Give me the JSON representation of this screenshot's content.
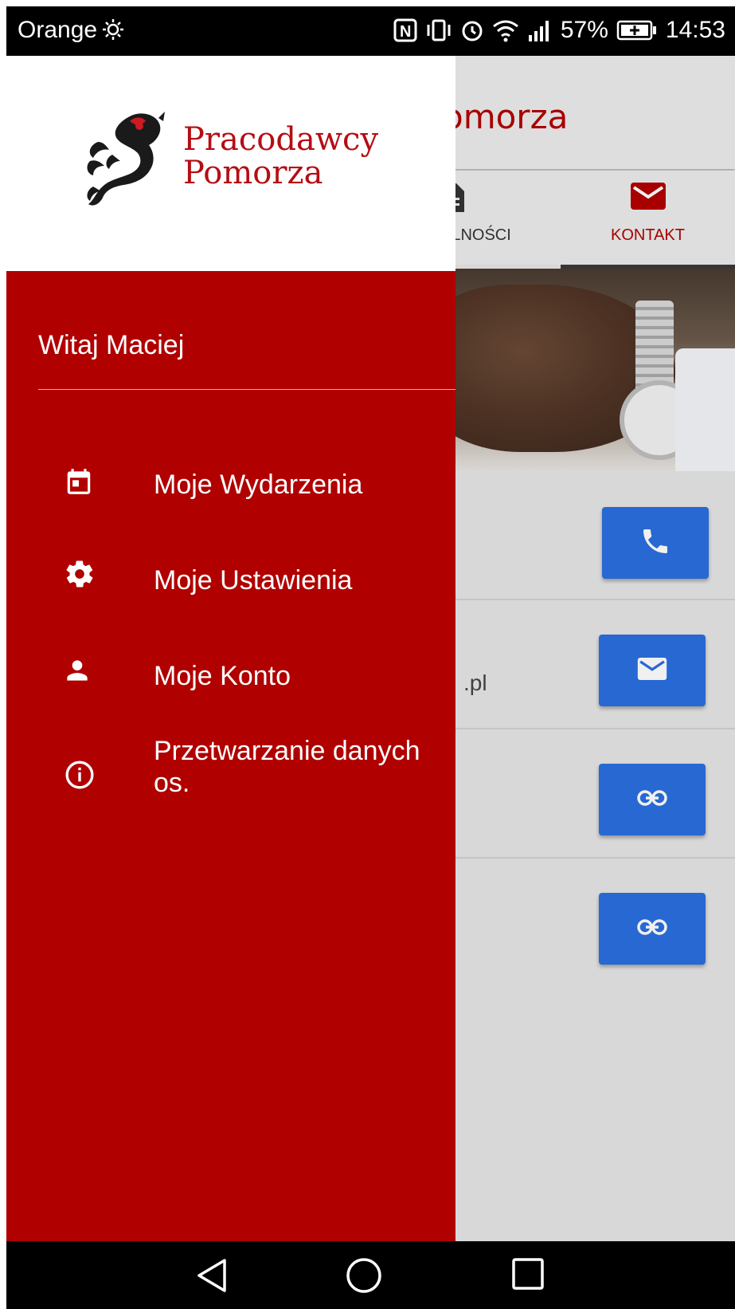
{
  "status_bar": {
    "carrier": "Orange",
    "battery": "57%",
    "time": "14:53"
  },
  "app": {
    "title_visible": "omorza",
    "tabs": [
      {
        "label": "ALNOŚCI",
        "icon": "document-icon"
      },
      {
        "label": "KONTAKT",
        "icon": "mail-icon",
        "active": true
      }
    ],
    "contact_rows": [
      {
        "value": "",
        "button_icon": "phone-icon"
      },
      {
        "value": ".pl",
        "button_icon": "mail-icon"
      },
      {
        "value": "",
        "button_icon": "link-icon"
      },
      {
        "value": "",
        "button_icon": "link-icon"
      }
    ]
  },
  "drawer": {
    "logo_line1": "Pracodawcy",
    "logo_line2": "Pomorza",
    "greeting": "Witaj Maciej",
    "items": [
      {
        "label": "Moje Wydarzenia",
        "icon": "calendar-icon"
      },
      {
        "label": "Moje Ustawienia",
        "icon": "gear-icon"
      },
      {
        "label": "Moje Konto",
        "icon": "person-icon"
      },
      {
        "label": "Przetwarzanie danych os.",
        "icon": "info-icon"
      }
    ]
  },
  "colors": {
    "drawer_red": "#b00000",
    "brand_red": "#b50d14",
    "button_blue": "#2a6fe0",
    "status_bar": "#000000"
  }
}
